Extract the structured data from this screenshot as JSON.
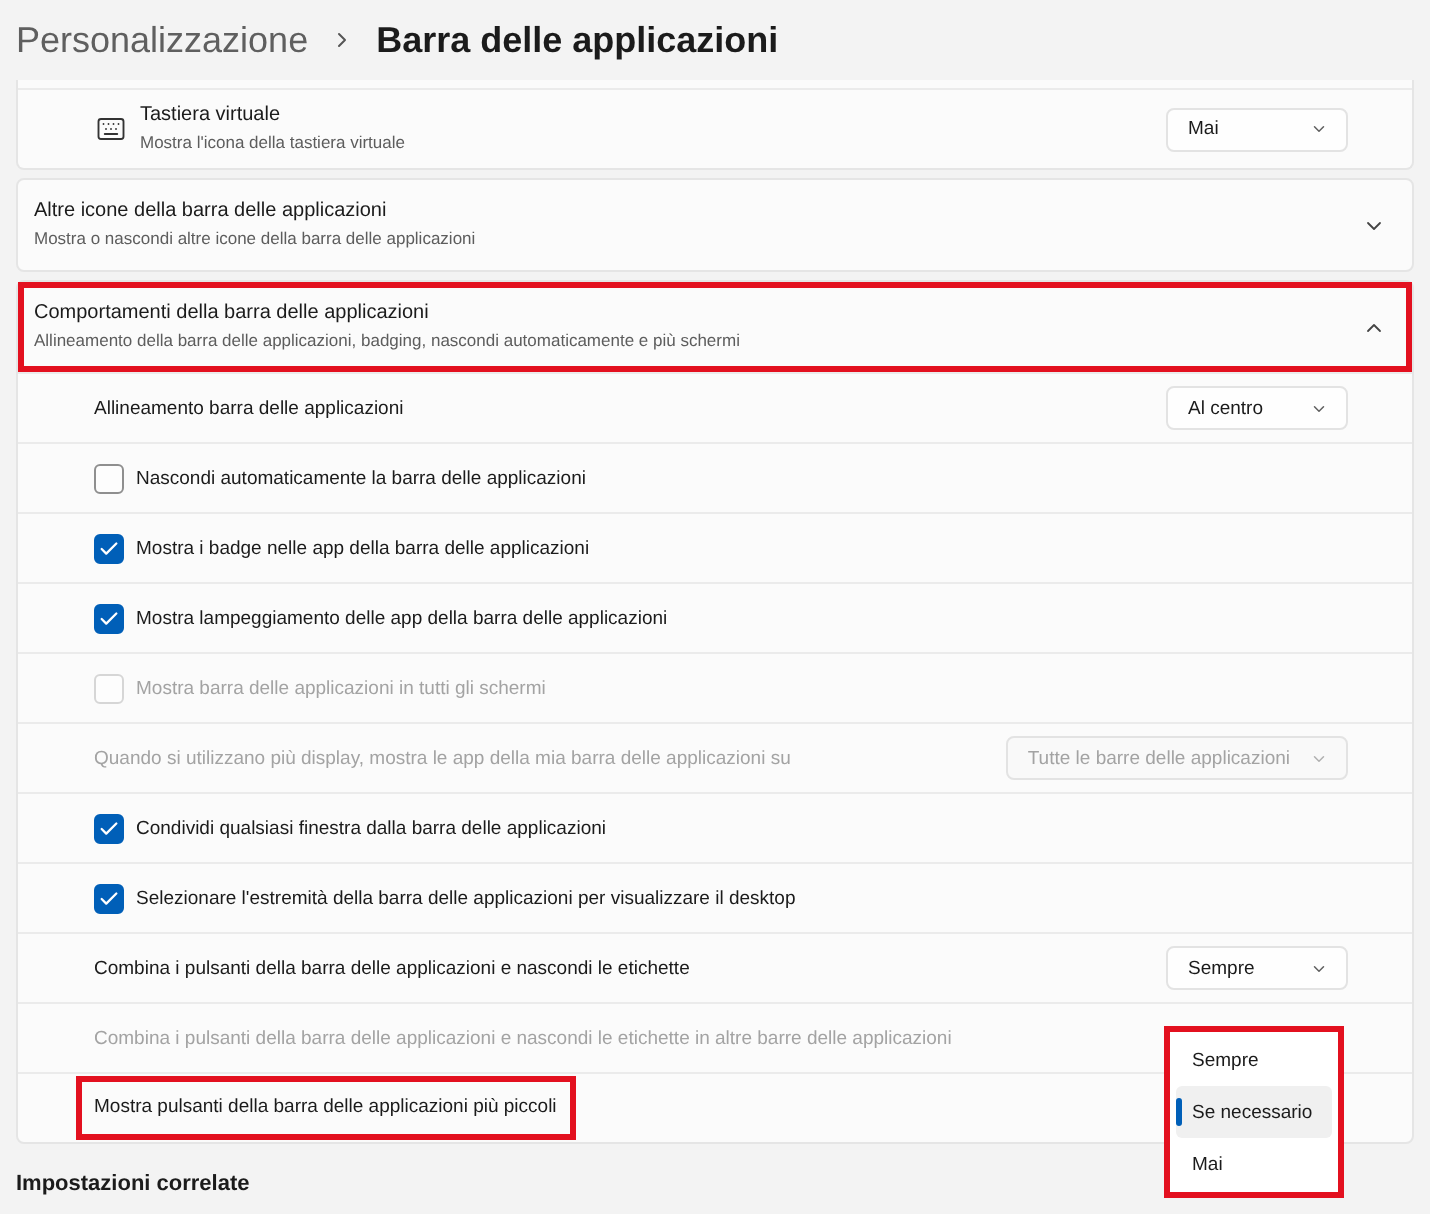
{
  "breadcrumb": {
    "parent": "Personalizzazione",
    "current": "Barra delle applicazioni"
  },
  "cards": [
    {
      "kind": "subsetting",
      "title": "Tastiera virtuale",
      "subtitle": "Mostra l'icona della tastiera virtuale",
      "value": "Mai"
    },
    {
      "kind": "section",
      "title": "Altre icone della barra delle applicazioni",
      "subtitle": "Mostra o nascondi altre icone della barra delle applicazioni",
      "expanded": false,
      "highlighted": false
    },
    {
      "kind": "section",
      "title": "Comportamenti della barra delle applicazioni",
      "subtitle": "Allineamento della barra delle applicazioni, badging, nascondi automaticamente e più schermi",
      "expanded": true,
      "highlighted": true,
      "rows": [
        {
          "kind": "dropdown",
          "label": "Allineamento barra delle applicazioni",
          "value": "Al centro",
          "disabled": false,
          "highlighted": false
        },
        {
          "kind": "checkbox",
          "label": "Nascondi automaticamente la barra delle applicazioni",
          "checked": false,
          "disabled": false,
          "highlighted": false
        },
        {
          "kind": "checkbox",
          "label": "Mostra i badge nelle app della barra delle applicazioni",
          "checked": true,
          "disabled": false,
          "highlighted": false
        },
        {
          "kind": "checkbox",
          "label": "Mostra lampeggiamento delle app della barra delle applicazioni",
          "checked": true,
          "disabled": false,
          "highlighted": false
        },
        {
          "kind": "checkbox",
          "label": "Mostra barra delle applicazioni in tutti gli schermi",
          "checked": false,
          "disabled": true,
          "highlighted": false
        },
        {
          "kind": "dropdown",
          "label": "Quando si utilizzano più display, mostra le app della mia barra delle applicazioni su",
          "value": "Tutte le barre delle applicazioni",
          "disabled": true,
          "highlighted": false
        },
        {
          "kind": "checkbox",
          "label": "Condividi qualsiasi finestra dalla barra delle applicazioni",
          "checked": true,
          "disabled": false,
          "highlighted": false
        },
        {
          "kind": "checkbox",
          "label": "Selezionare l'estremità della barra delle applicazioni per visualizzare il desktop",
          "checked": true,
          "disabled": false,
          "highlighted": false
        },
        {
          "kind": "dropdown",
          "label": "Combina i pulsanti della barra delle applicazioni e nascondi le etichette",
          "value": "Sempre",
          "disabled": false,
          "highlighted": false
        },
        {
          "kind": "label",
          "label": "Combina i pulsanti della barra delle applicazioni e nascondi le etichette in altre barre delle applicazioni",
          "disabled": true,
          "highlighted": false
        },
        {
          "kind": "menu",
          "label": "Mostra pulsanti della barra delle applicazioni più piccoli",
          "disabled": false,
          "highlighted": true,
          "menu": {
            "highlighted": true,
            "options": [
              {
                "label": "Sempre",
                "selected": false
              },
              {
                "label": "Se necessario",
                "selected": true
              },
              {
                "label": "Mai",
                "selected": false
              }
            ]
          }
        }
      ]
    }
  ],
  "related_heading": "Impostazioni correlate"
}
